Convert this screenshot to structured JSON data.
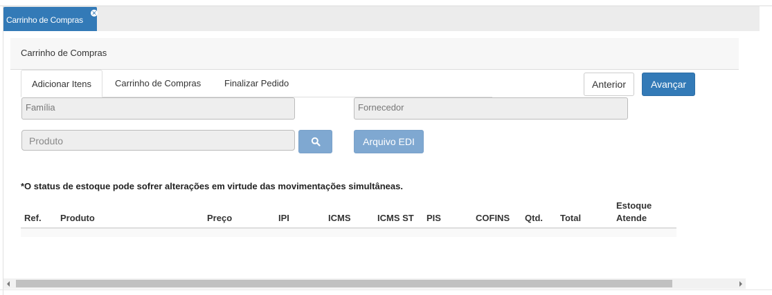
{
  "doc_tab": {
    "label": "Carrinho de Compras",
    "close_glyph": "✕"
  },
  "panel": {
    "title": "Carrinho de Compras"
  },
  "tabs": [
    {
      "label": "Adicionar Itens",
      "active": true
    },
    {
      "label": "Carrinho de Compras",
      "active": false
    },
    {
      "label": "Finalizar Pedido",
      "active": false
    }
  ],
  "actions": {
    "prev_label": "Anterior",
    "next_label": "Avançar"
  },
  "filters": {
    "familia_placeholder": "Família",
    "fornecedor_placeholder": "Fornecedor",
    "produto_placeholder": "Produto",
    "search_icon": "search-icon",
    "edi_label": "Arquivo EDI"
  },
  "notice": "*O status de estoque pode sofrer alterações em virtude das movimentações simultâneas.",
  "table": {
    "headers": [
      "Ref.",
      "Produto",
      "Preço",
      "IPI",
      "ICMS",
      "ICMS ST",
      "PIS",
      "COFINS",
      "Qtd.",
      "Total",
      "Estoque",
      "Atende"
    ]
  },
  "colors": {
    "primary": "#337ab7",
    "primary_disabled": "#7fa8d1"
  }
}
